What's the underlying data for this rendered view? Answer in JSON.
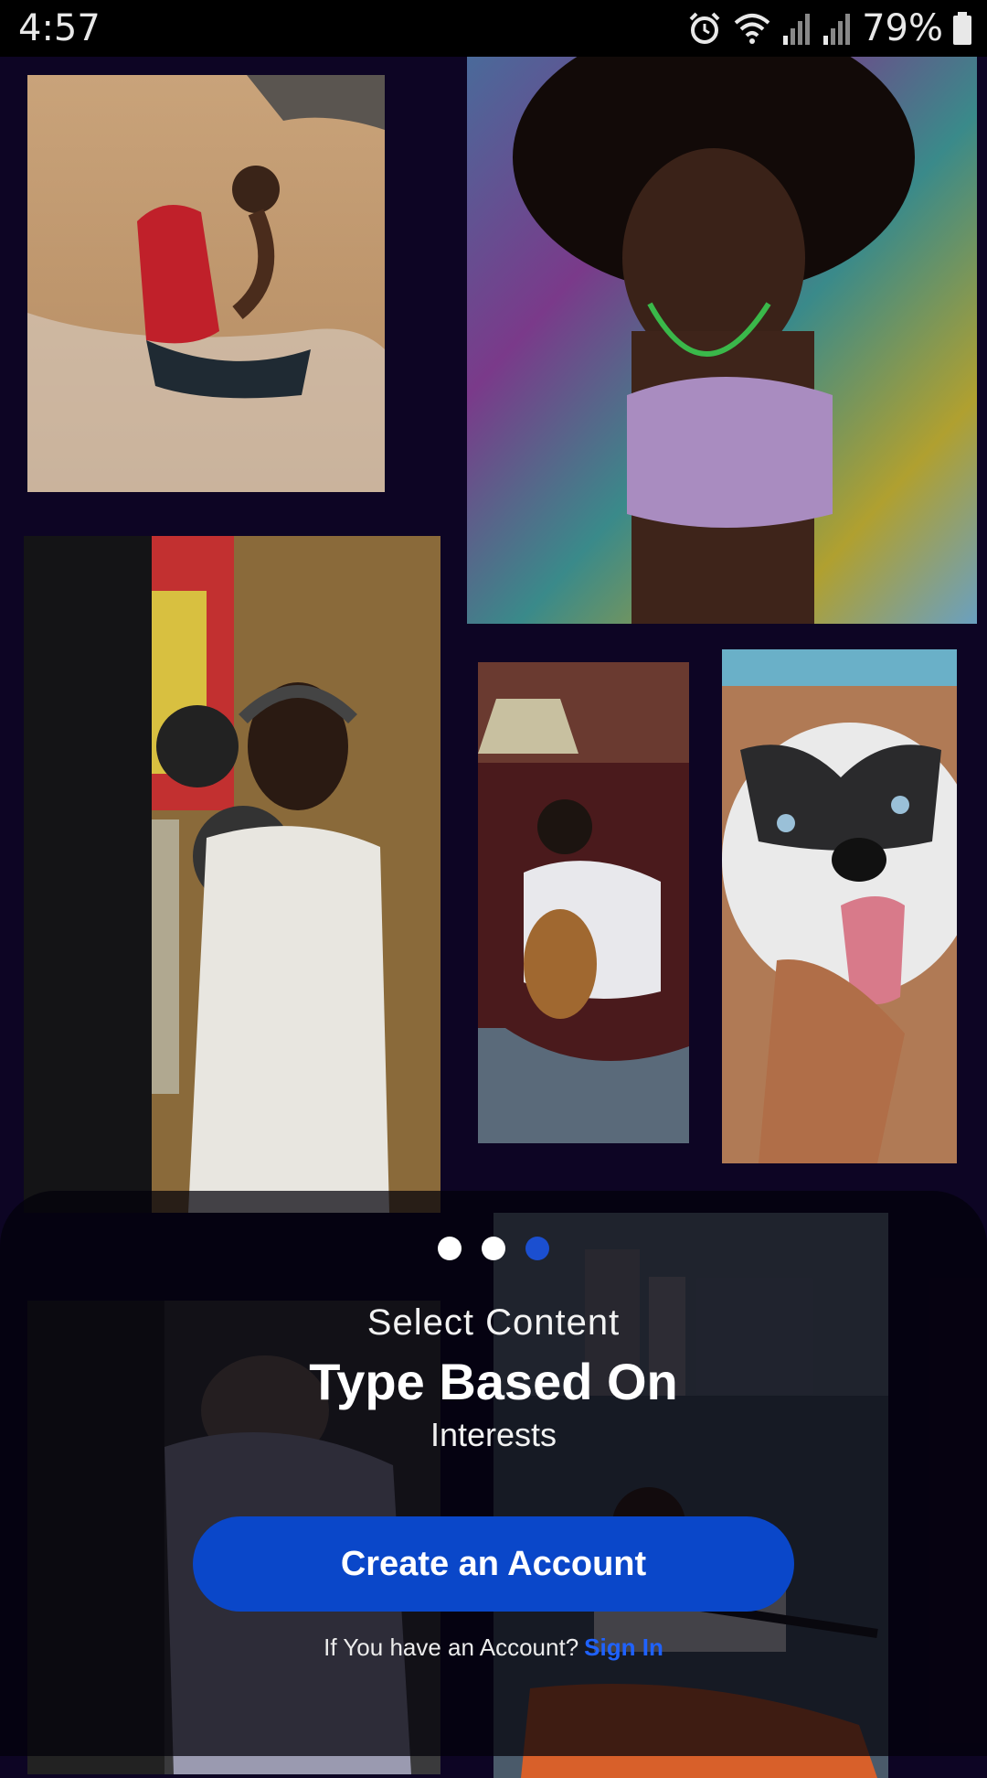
{
  "status": {
    "time": "4:57",
    "battery_pct": "79%",
    "icons": [
      "alarm-icon",
      "wifi-icon",
      "signal-icon",
      "signal-icon",
      "battery-icon"
    ]
  },
  "carousel": {
    "total": 3,
    "active_index": 2
  },
  "onboarding": {
    "line1": "Select Content",
    "line2": "Type Based On",
    "line3": "Interests"
  },
  "cta": {
    "label": "Create an Account"
  },
  "signin": {
    "prompt": "If You have an Account?",
    "link_label": "Sign In"
  },
  "colors": {
    "background": "#0d0524",
    "accent": "#0a47c9",
    "link": "#1f62ff"
  }
}
